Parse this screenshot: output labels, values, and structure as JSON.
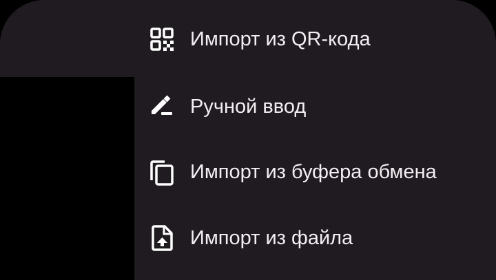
{
  "menu": {
    "items": [
      {
        "label": "Импорт из QR-кода",
        "icon": "qr-code-icon"
      },
      {
        "label": "Ручной ввод",
        "icon": "edit-pencil-icon"
      },
      {
        "label": "Импорт из буфера обмена",
        "icon": "copy-clipboard-icon"
      },
      {
        "label": "Импорт из файла",
        "icon": "file-upload-icon"
      }
    ]
  },
  "colors": {
    "sheet_background": "#1f1b20",
    "backdrop": "#000000",
    "text": "#f2eef2",
    "icon": "#ffffff"
  }
}
